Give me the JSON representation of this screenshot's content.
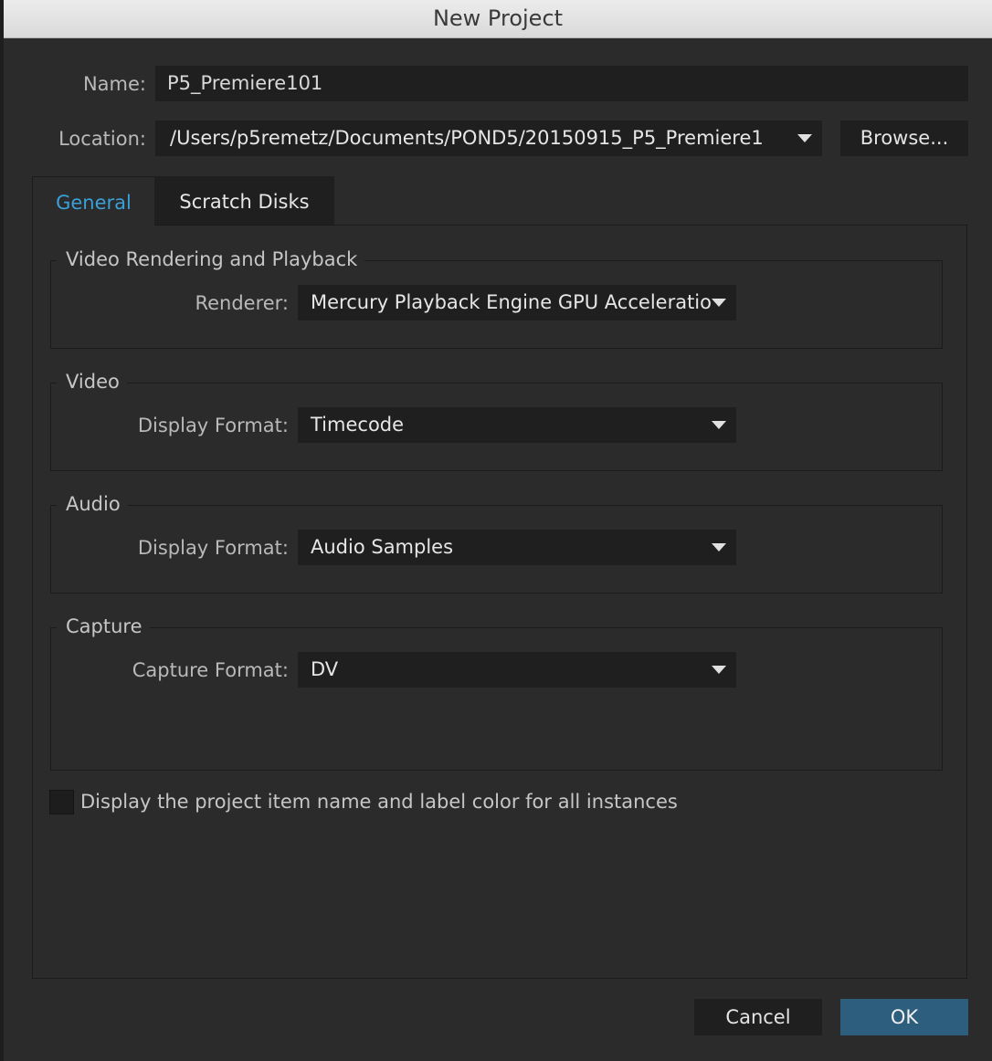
{
  "window": {
    "title": "New Project"
  },
  "form": {
    "name_label": "Name:",
    "name_value": "P5_Premiere101",
    "location_label": "Location:",
    "location_value": "/Users/p5remetz/Documents/POND5/20150915_P5_Premiere1",
    "browse_label": "Browse..."
  },
  "tabs": [
    {
      "label": "General",
      "active": true
    },
    {
      "label": "Scratch Disks",
      "active": false
    }
  ],
  "groups": {
    "rendering": {
      "title": "Video Rendering and Playback",
      "field_label": "Renderer:",
      "value": "Mercury Playback Engine GPU Acceleratio"
    },
    "video": {
      "title": "Video",
      "field_label": "Display Format:",
      "value": "Timecode"
    },
    "audio": {
      "title": "Audio",
      "field_label": "Display Format:",
      "value": "Audio Samples"
    },
    "capture": {
      "title": "Capture",
      "field_label": "Capture Format:",
      "value": "DV"
    }
  },
  "checkbox": {
    "label": "Display the project item name and label color for all instances",
    "checked": false
  },
  "buttons": {
    "cancel": "Cancel",
    "ok": "OK"
  },
  "colors": {
    "accent": "#2e5e7d",
    "active_tab_text": "#3aa0d8",
    "background": "#2b2b2b",
    "field": "#1f1f1f"
  },
  "icons": {
    "dropdown": "chevron-down-icon"
  }
}
